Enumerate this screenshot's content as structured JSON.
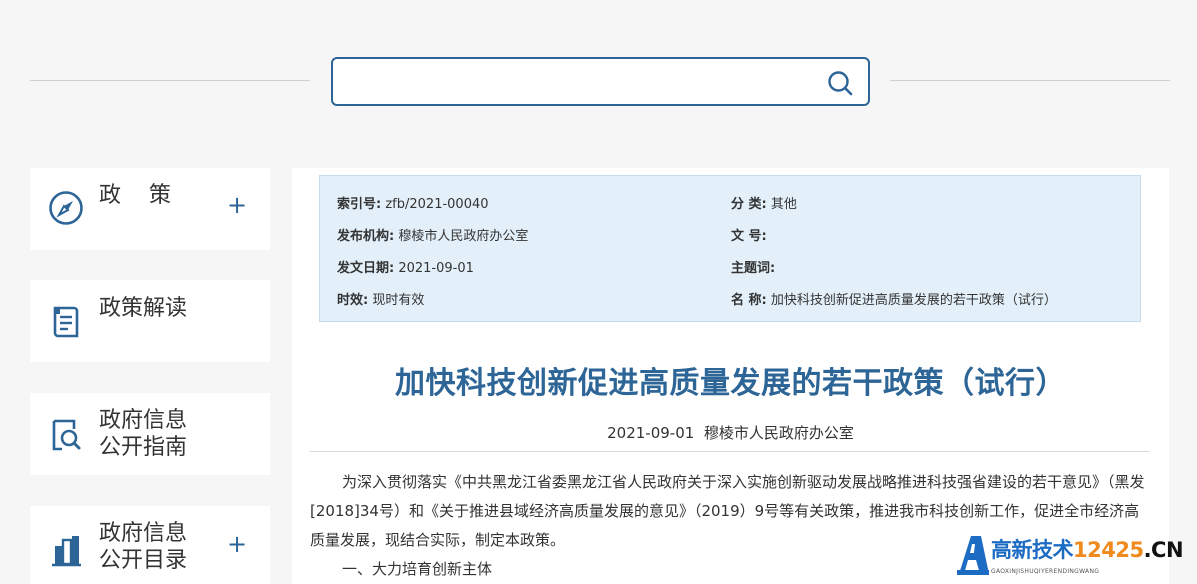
{
  "search": {
    "placeholder": "",
    "value": ""
  },
  "sidebar": {
    "items": [
      {
        "label": "政    策",
        "icon": "compass-icon",
        "has_plus": true,
        "plus": "+"
      },
      {
        "label": "政策解读",
        "icon": "document-icon",
        "has_plus": false
      },
      {
        "label": "政府信息\n公开指南",
        "icon": "search-document-icon",
        "has_plus": false
      },
      {
        "label": "政府信息\n公开目录",
        "icon": "building-icon",
        "has_plus": true,
        "plus": "+"
      }
    ]
  },
  "meta": {
    "index_label": "索引号:",
    "index_value": "zfb/2021-00040",
    "category_label": "分 类:",
    "category_value": "其他",
    "publisher_label": "发布机构:",
    "publisher_value": "穆棱市人民政府办公室",
    "doc_no_label": "文 号:",
    "doc_no_value": "",
    "date_label": "发文日期:",
    "date_value": "2021-09-01",
    "subject_label": "主题词:",
    "subject_value": "",
    "validity_label": "时效:",
    "validity_value": "现时有效",
    "name_label": "名 称:",
    "name_value": "加快科技创新促进高质量发展的若干政策（试行）"
  },
  "article": {
    "title": "加快科技创新促进高质量发展的若干政策（试行）",
    "date": "2021-09-01",
    "publisher": "穆棱市人民政府办公室",
    "paragraph1": "为深入贯彻落实《中共黑龙江省委黑龙江省人民政府关于深入实施创新驱动发展战略推进科技强省建设的若干意见》（黑发[2018]34号）和《关于推进县域经济高质量发展的意见》（2019）9号等有关政策，推进我市科技创新工作，促进全市经济高质量发展，现结合实际，制定本政策。",
    "section1": "一、大力培育创新主体"
  },
  "watermark": {
    "brand": "高新技术",
    "number": "12425",
    "tld": ".CN",
    "sub": "GAOXINJISHUQIYERENDINGWANG"
  },
  "colors": {
    "accent": "#2d6597",
    "meta_bg": "#e3f0fa",
    "page_bg": "#f6f6f6"
  }
}
